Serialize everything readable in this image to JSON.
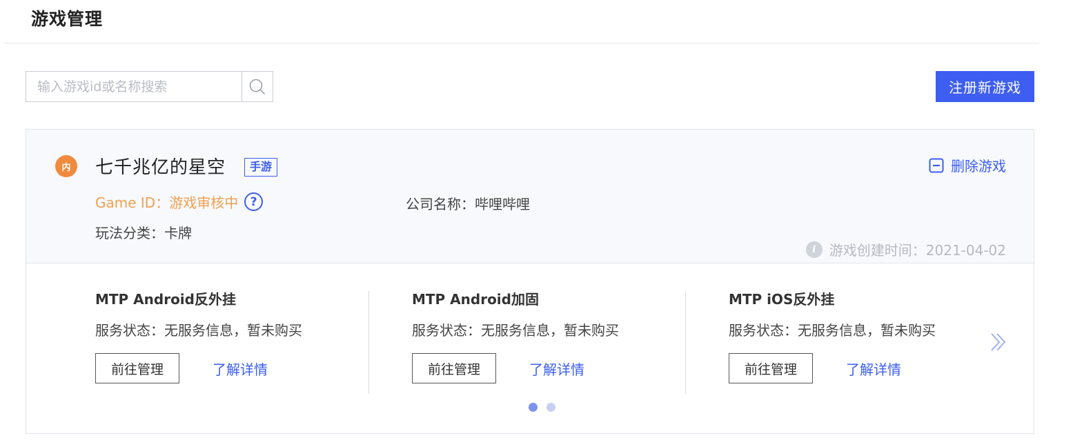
{
  "page": {
    "title": "游戏管理"
  },
  "search": {
    "placeholder": "输入游戏id或名称搜索"
  },
  "actions": {
    "register_label": "注册新游戏"
  },
  "game": {
    "logo_text": "内",
    "name": "七千兆亿的星空",
    "tag": "手游",
    "delete_label": "删除游戏",
    "game_id_text": "Game ID：游戏审核中",
    "company_text": "公司名称：哔哩哔哩",
    "category_text": "玩法分类：卡牌",
    "created_text": "游戏创建时间：2021-04-02"
  },
  "services": [
    {
      "title": "MTP Android反外挂",
      "status": "服务状态：无服务信息，暂未购买",
      "manage_label": "前往管理",
      "detail_label": "了解详情"
    },
    {
      "title": "MTP Android加固",
      "status": "服务状态：无服务信息，暂未购买",
      "manage_label": "前往管理",
      "detail_label": "了解详情"
    },
    {
      "title": "MTP iOS反外挂",
      "status": "服务状态：无服务信息，暂未购买",
      "manage_label": "前往管理",
      "detail_label": "了解详情"
    }
  ],
  "pagination": {
    "total": 2,
    "active": 1
  },
  "colors": {
    "accent": "#3d5ef0",
    "pending": "#f0a050",
    "logo": "#f08a3c"
  }
}
